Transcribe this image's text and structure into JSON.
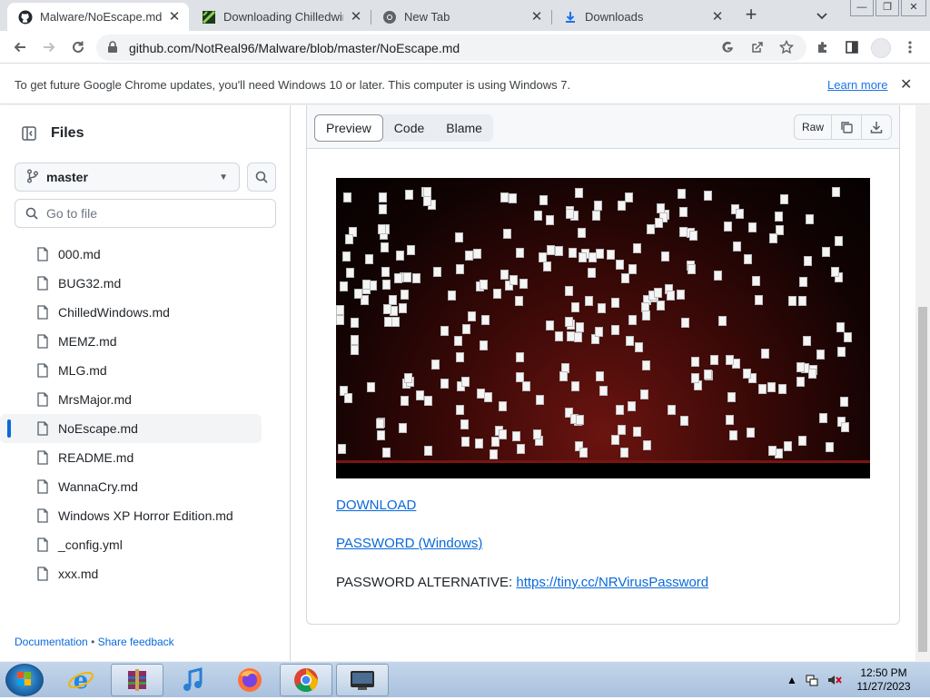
{
  "tabs": [
    {
      "title": "Malware/NoEscape.md at",
      "active": true
    },
    {
      "title": "Downloading Chilledwind",
      "active": false
    },
    {
      "title": "New Tab",
      "active": false
    },
    {
      "title": "Downloads",
      "active": false
    }
  ],
  "window_controls": {
    "minimize": "—",
    "restore": "❐",
    "close": "✕"
  },
  "omnibox": {
    "url": "github.com/NotReal96/Malware/blob/master/NoEscape.md"
  },
  "infobar": {
    "message": "To get future Google Chrome updates, you'll need Windows 10 or later. This computer is using Windows 7.",
    "link": "Learn more"
  },
  "sidebar": {
    "title": "Files",
    "branch": "master",
    "search_placeholder": "Go to file",
    "files": [
      {
        "name": "000.md"
      },
      {
        "name": "BUG32.md"
      },
      {
        "name": "ChilledWindows.md"
      },
      {
        "name": "MEMZ.md"
      },
      {
        "name": "MLG.md"
      },
      {
        "name": "MrsMajor.md"
      },
      {
        "name": "NoEscape.md",
        "active": true
      },
      {
        "name": "README.md"
      },
      {
        "name": "WannaCry.md"
      },
      {
        "name": "Windows XP Horror Edition.md"
      },
      {
        "name": "_config.yml"
      },
      {
        "name": "xxx.md"
      }
    ],
    "footer": {
      "documentation": "Documentation",
      "separator": "•",
      "feedback": "Share feedback"
    }
  },
  "viewer": {
    "tabs": {
      "preview": "Preview",
      "code": "Code",
      "blame": "Blame"
    },
    "raw_label": "Raw"
  },
  "content": {
    "download_link": "DOWNLOAD",
    "password_link": "PASSWORD (Windows)",
    "password_alt_label": "PASSWORD ALTERNATIVE:",
    "password_alt_url": "https://tiny.cc/NRVirusPassword"
  },
  "taskbar": {
    "time": "12:50 PM",
    "date": "11/27/2023"
  },
  "colors": {
    "link": "#0969da",
    "chrome_link": "#1a73e8",
    "active_accent": "#0969da",
    "taskbar": "#b7cbe3"
  }
}
